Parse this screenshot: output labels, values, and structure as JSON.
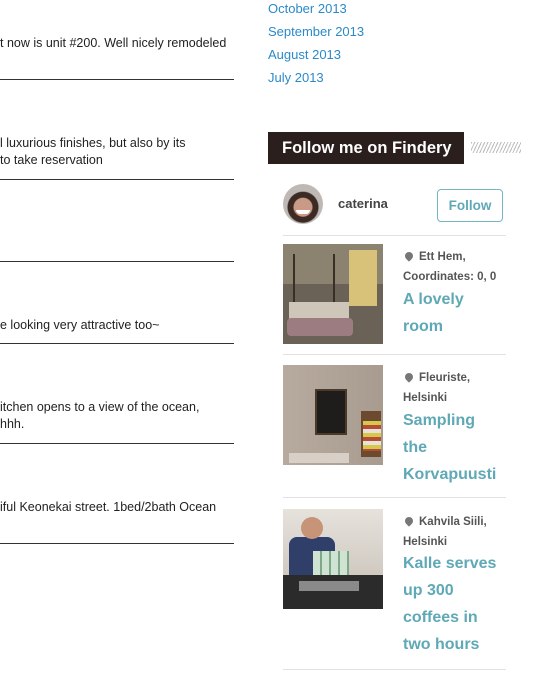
{
  "posts": [
    {
      "text": "t now is unit #200. Well nicely remodeled"
    },
    {
      "line1": "l luxurious finishes, but also by its",
      "line2": " to take reservation"
    },
    {
      "text": "e looking very attractive too~"
    },
    {
      "line1": "itchen opens to a view of the ocean,",
      "line2": "hhh."
    },
    {
      "text": "iful Keonekai street. 1bed/2bath Ocean"
    }
  ],
  "archives": [
    "October 2013",
    "September 2013",
    "August 2013",
    "July 2013"
  ],
  "findery": {
    "title": "Follow me on Findery",
    "username": "caterina",
    "follow_label": "Follow",
    "notes": [
      {
        "place": "Ett Hem,",
        "place2": "Coordinates: 0, 0",
        "title_lines": [
          "A lovely",
          "room"
        ]
      },
      {
        "place": "Fleuriste,",
        "place2": "Helsinki",
        "title_lines": [
          "Sampling",
          "the",
          "Korvapuusti"
        ]
      },
      {
        "place": "Kahvila Siili,",
        "place2": "Helsinki",
        "title_lines": [
          "Kalle serves",
          "up 300",
          "coffees in",
          "two hours"
        ]
      }
    ]
  },
  "icons": {
    "location": "map-pin-icon"
  },
  "colors": {
    "link": "#2a8ac9",
    "accent": "#5fa8b6",
    "title_bg": "#2a1f1c"
  }
}
